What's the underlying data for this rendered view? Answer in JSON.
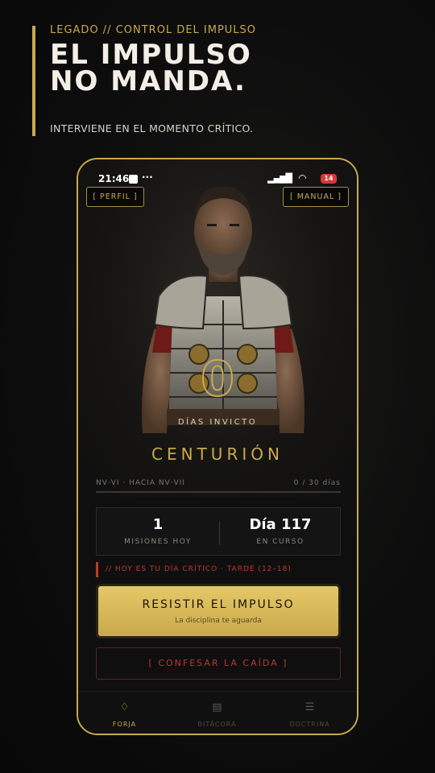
{
  "header": {
    "kicker": "LEGADO  //  CONTROL DEL IMPULSO",
    "headline_line1": "EL IMPULSO",
    "headline_line2": "NO MANDA.",
    "tagline": "INTERVIENE EN EL MOMENTO CRÍTICO."
  },
  "status_bar": {
    "time": "21:46",
    "dots": "···",
    "battery": "14"
  },
  "top_buttons": {
    "perfil": "[ PERFIL ]",
    "manual": "[ MANUAL ]"
  },
  "hero": {
    "streak_value": "0",
    "streak_label": "DÍAS INVICTO",
    "rank": "CENTURIÓN"
  },
  "level": {
    "label": "NV·VI  ·  HACIA NV·VII",
    "progress_text": "0 / 30 días",
    "progress_fraction": 0
  },
  "stats": [
    {
      "value": "1",
      "label": "MISIONES HOY"
    },
    {
      "value": "Día 117",
      "label": "EN CURSO"
    }
  ],
  "alert": "// HOY ES TU DÍA CRÍTICO · TARDE (12–18)",
  "cta": {
    "title": "RESISTIR EL IMPULSO",
    "subtitle": "La disciplina te aguarda"
  },
  "confess_button": "[ CONFESAR LA CAÍDA ]",
  "nav": [
    {
      "label": "FORJA",
      "icon": "flame-icon",
      "active": true
    },
    {
      "label": "BITÁCORA",
      "icon": "journal-icon",
      "active": false
    },
    {
      "label": "DOCTRINA",
      "icon": "scroll-icon",
      "active": false
    }
  ],
  "colors": {
    "gold": "#c9a94b",
    "alert_red": "#c0392b",
    "background": "#0d0d0d"
  }
}
